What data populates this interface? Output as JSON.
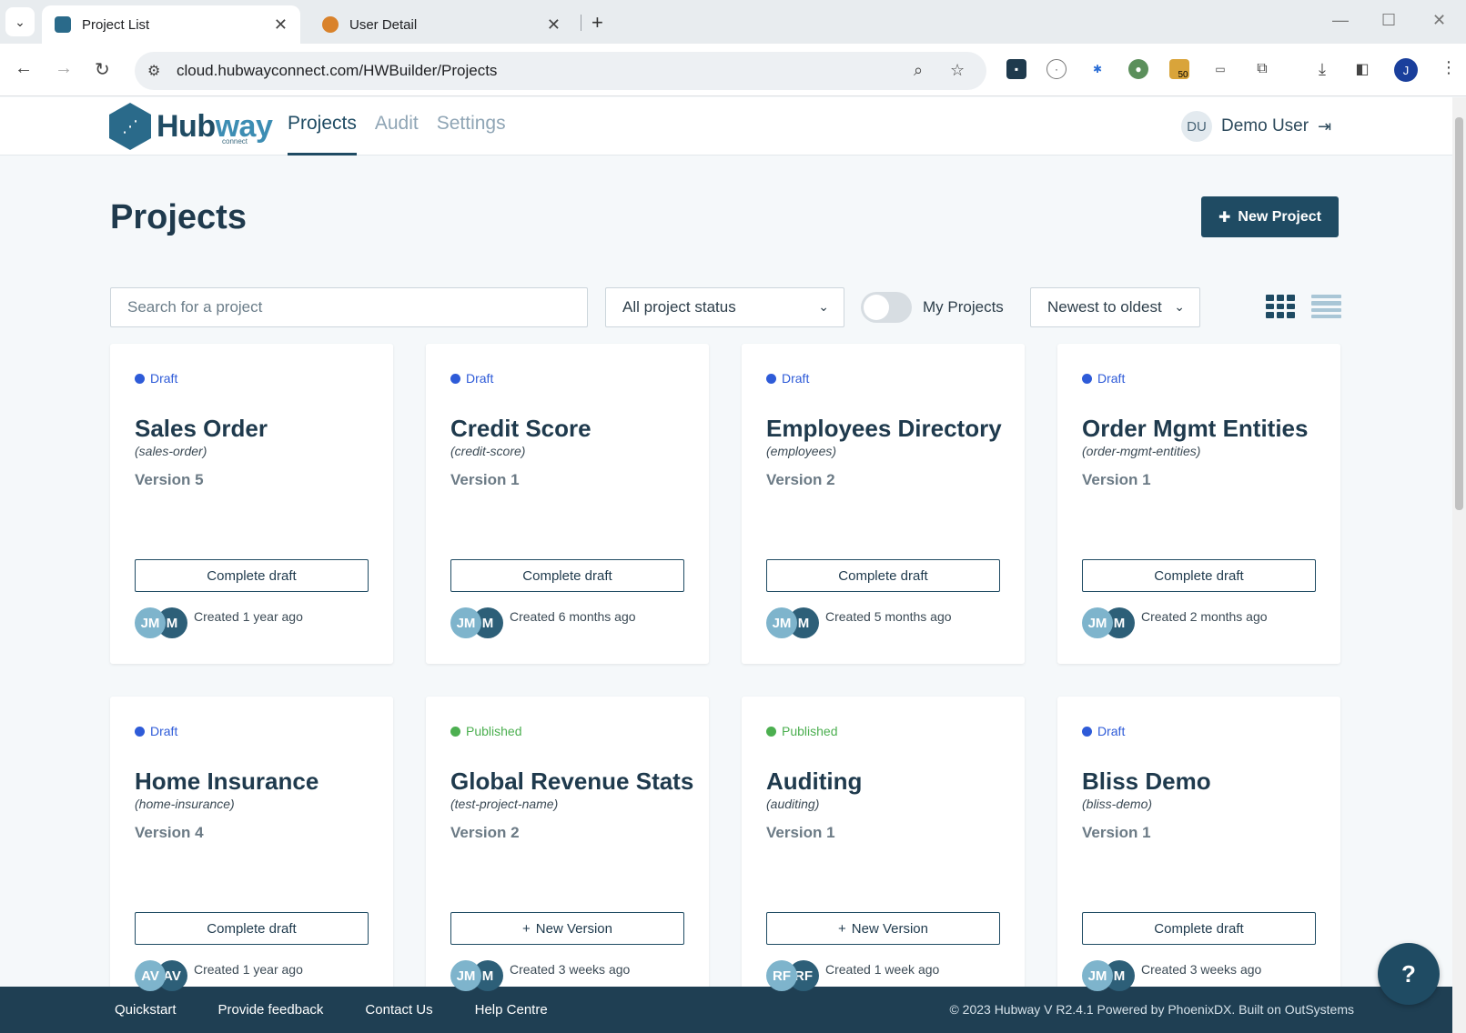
{
  "browser": {
    "tabs": [
      {
        "title": "Project List",
        "active": true
      },
      {
        "title": "User Detail",
        "active": false
      }
    ],
    "url": "cloud.hubwayconnect.com/HWBuilder/Projects",
    "profile_initial": "J",
    "extension_badge": "50"
  },
  "header": {
    "logo_text_a": "Hub",
    "logo_text_b": "way",
    "logo_sub": "connect",
    "nav": [
      {
        "label": "Projects",
        "active": true
      },
      {
        "label": "Audit",
        "active": false
      },
      {
        "label": "Settings",
        "active": false
      }
    ],
    "user_initials": "DU",
    "user_name": "Demo User"
  },
  "page": {
    "title": "Projects",
    "new_project_label": "New Project"
  },
  "filters": {
    "search_placeholder": "Search for a project",
    "status_value": "All project status",
    "my_projects_label": "My Projects",
    "my_projects_on": false,
    "sort_value": "Newest to oldest",
    "view_mode": "grid"
  },
  "status_colors": {
    "Draft": "#2e5bd8",
    "Published": "#4caf50"
  },
  "projects": [
    {
      "status": "Draft",
      "title": "Sales Order",
      "slug": "(sales-order)",
      "version": "Version 5",
      "action": "Complete draft",
      "avatars": [
        "JM",
        "M"
      ],
      "created": "Created 1 year ago"
    },
    {
      "status": "Draft",
      "title": "Credit Score",
      "slug": "(credit-score)",
      "version": "Version 1",
      "action": "Complete draft",
      "avatars": [
        "JM",
        "M"
      ],
      "created": "Created 6 months ago"
    },
    {
      "status": "Draft",
      "title": "Employees Directory",
      "slug": "(employees)",
      "version": "Version 2",
      "action": "Complete draft",
      "avatars": [
        "JM",
        "M"
      ],
      "created": "Created 5 months ago"
    },
    {
      "status": "Draft",
      "title": "Order Mgmt Entities",
      "slug": "(order-mgmt-entities)",
      "version": "Version 1",
      "action": "Complete draft",
      "avatars": [
        "JM",
        "M"
      ],
      "created": "Created 2 months ago"
    },
    {
      "status": "Draft",
      "title": "Home Insurance",
      "slug": "(home-insurance)",
      "version": "Version 4",
      "action": "Complete draft",
      "avatars": [
        "AV",
        "AV"
      ],
      "created": "Created 1 year ago"
    },
    {
      "status": "Published",
      "title": "Global Revenue Stats",
      "slug": "(test-project-name)",
      "version": "Version 2",
      "action": "New Version",
      "avatars": [
        "JM",
        "M"
      ],
      "created": "Created 3 weeks ago"
    },
    {
      "status": "Published",
      "title": "Auditing",
      "slug": "(auditing)",
      "version": "Version 1",
      "action": "New Version",
      "avatars": [
        "RF",
        "RF"
      ],
      "created": "Created 1 week ago"
    },
    {
      "status": "Draft",
      "title": "Bliss Demo",
      "slug": "(bliss-demo)",
      "version": "Version 1",
      "action": "Complete draft",
      "avatars": [
        "JM",
        "M"
      ],
      "created": "Created 3 weeks ago"
    }
  ],
  "footer": {
    "links": [
      "Quickstart",
      "Provide feedback",
      "Contact Us",
      "Help Centre"
    ],
    "copyright": "© 2023 Hubway V R2.4.1 Powered by PhoenixDX. Built on OutSystems"
  },
  "help_label": "?"
}
